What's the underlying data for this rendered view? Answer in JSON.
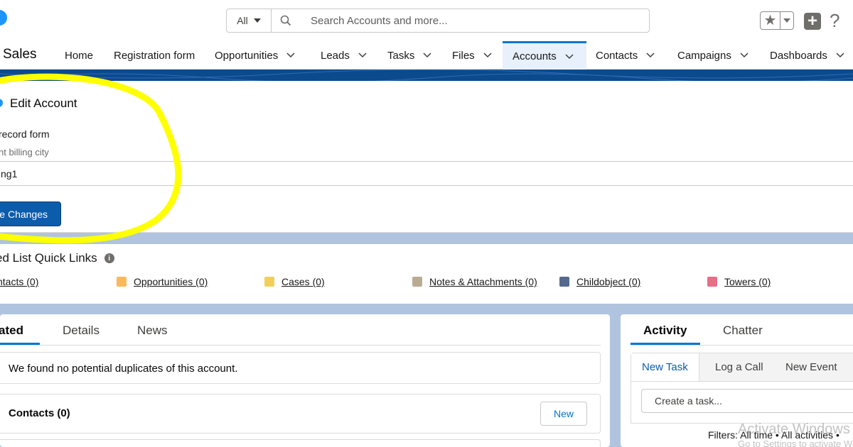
{
  "header": {
    "search_scope": "All",
    "search_placeholder": "Search Accounts and more..."
  },
  "nav": {
    "app_name": "Sales",
    "items": [
      {
        "label": "Home"
      },
      {
        "label": "Registration form"
      },
      {
        "label": "Opportunities"
      },
      {
        "label": "Leads"
      },
      {
        "label": "Tasks"
      },
      {
        "label": "Files"
      },
      {
        "label": "Accounts"
      },
      {
        "label": "Contacts"
      },
      {
        "label": "Campaigns"
      },
      {
        "label": "Dashboards"
      }
    ],
    "active": "Accounts"
  },
  "edit_card": {
    "title": "Edit Account",
    "form_title": "record form",
    "field_label": "nt billing city",
    "field_value": "ng1",
    "save_label": "e Changes"
  },
  "quick_links": {
    "title": "ed List Quick Links",
    "links": [
      {
        "label": "ntacts (0)",
        "color": "#a094ed"
      },
      {
        "label": "Opportunities (0)",
        "color": "#fcb95b"
      },
      {
        "label": "Cases (0)",
        "color": "#f2cf5b"
      },
      {
        "label": "Notes & Attachments (0)",
        "color": "#baac93"
      },
      {
        "label": "Childobject (0)",
        "color": "#54698d"
      },
      {
        "label": "Towers (0)",
        "color": "#e46f86"
      }
    ]
  },
  "related": {
    "tabs": [
      "ated",
      "Details",
      "News"
    ],
    "duplicates_text": "We found no potential duplicates of this account.",
    "contacts_title": "Contacts (0)",
    "new_label": "New"
  },
  "activity": {
    "tabs": [
      "Activity",
      "Chatter"
    ],
    "subtabs": [
      "New Task",
      "Log a Call",
      "New Event"
    ],
    "task_placeholder": "Create a task...",
    "filters": "Filters: All time • All activities •"
  },
  "watermark": {
    "line1": "Activate Windows",
    "line2": "Go to Settings to activate Windows."
  },
  "colors": {
    "brand": "#0176d3",
    "banner": "#0c4a8e",
    "highlight": "#ffff00"
  }
}
